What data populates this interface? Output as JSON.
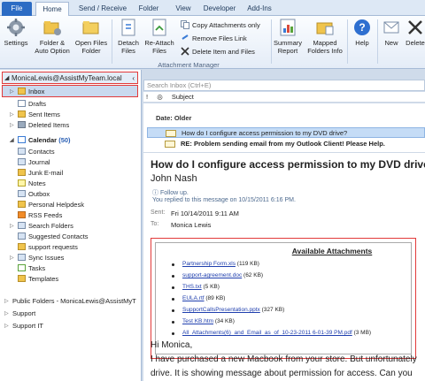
{
  "tabs": [
    "File",
    "Home",
    "Send / Receive",
    "Folder",
    "View",
    "Developer",
    "Add-Ins"
  ],
  "ribbon": {
    "settings": "Settings",
    "folder_auto_1": "Folder &",
    "folder_auto_2": "Auto Option",
    "open_files_1": "Open Files",
    "open_files_2": "Folder",
    "detach_1": "Detach",
    "detach_2": "Files",
    "reattach_1": "Re-Attach",
    "reattach_2": "Files",
    "copy_only": "Copy Attachments only",
    "remove_link": "Remove Files Link",
    "delete_item": "Delete Item and Files",
    "summary_1": "Summary",
    "summary_2": "Report",
    "mapped_1": "Mapped",
    "mapped_2": "Folders Info",
    "help": "Help",
    "new": "New",
    "delete": "Delete",
    "group_label": "Attachment Manager"
  },
  "nav": {
    "header": "MonicaLewis@AssistMyTeam.local",
    "items": [
      {
        "label": "Inbox",
        "count": ""
      },
      {
        "label": "Drafts",
        "count": ""
      },
      {
        "label": "Sent Items",
        "count": ""
      },
      {
        "label": "Deleted Items",
        "count": ""
      },
      {
        "label": "Calendar",
        "count": "(50)"
      },
      {
        "label": "Contacts",
        "count": ""
      },
      {
        "label": "Journal",
        "count": ""
      },
      {
        "label": "Junk E-mail",
        "count": ""
      },
      {
        "label": "Notes",
        "count": ""
      },
      {
        "label": "Outbox",
        "count": ""
      },
      {
        "label": "Personal Helpdesk",
        "count": ""
      },
      {
        "label": "RSS Feeds",
        "count": ""
      },
      {
        "label": "Search Folders",
        "count": ""
      },
      {
        "label": "Suggested Contacts",
        "count": ""
      },
      {
        "label": "support requests",
        "count": ""
      },
      {
        "label": "Sync Issues",
        "count": ""
      },
      {
        "label": "Tasks",
        "count": ""
      },
      {
        "label": "Templates",
        "count": ""
      },
      {
        "label": "Public Folders - MonicaLewis@AssistMyT",
        "count": ""
      },
      {
        "label": "Support",
        "count": ""
      },
      {
        "label": "Support IT",
        "count": ""
      }
    ]
  },
  "list": {
    "search_placeholder": "Search Inbox (Ctrl+E)",
    "col_subject": "Subject",
    "date_group": "Date: Older",
    "messages": [
      "How do I configure access permission to my DVD drive?",
      "RE: Problem sending email from my Outlook Client! Please Help."
    ]
  },
  "reading": {
    "subject": "How do I configure access permission to my DVD drive?",
    "sender": "John Nash",
    "follow_up": "Follow up.",
    "replied": "You replied to this message on 10/15/2011 6:16 PM.",
    "sent_label": "Sent:",
    "sent_value": "Fri 10/14/2011 9:11 AM",
    "to_label": "To:",
    "to_value": "Monica Lewis",
    "attach_title": "Available Attachments",
    "attachments": [
      {
        "name": "Partnership Form.xls",
        "size": "(119 KB)"
      },
      {
        "name": "support-agreement.doc",
        "size": "(62 KB)"
      },
      {
        "name": "THS.txt",
        "size": "(5 KB)"
      },
      {
        "name": "EULA.rtf",
        "size": "(89 KB)"
      },
      {
        "name": "SupportCallsPresentation.pptx",
        "size": "(327 KB)"
      },
      {
        "name": "Test KB.htm",
        "size": "(34 KB)"
      },
      {
        "name": "All_Attachments(6)_and_Email_as_of_10-23-2011 6-01-39 PM.pdf",
        "size": "(3 MB)"
      }
    ],
    "greeting": "Hi Monica,",
    "body_1": "I have purchased a new Macbook from your store. But unfortunately",
    "body_2": "drive. It is showing message about permission for access. Can you"
  },
  "colors": {
    "accent": "#2c6cc4",
    "highlight": "#e23a3a",
    "selection": "#c5dcf6",
    "link": "#1f3fae"
  }
}
